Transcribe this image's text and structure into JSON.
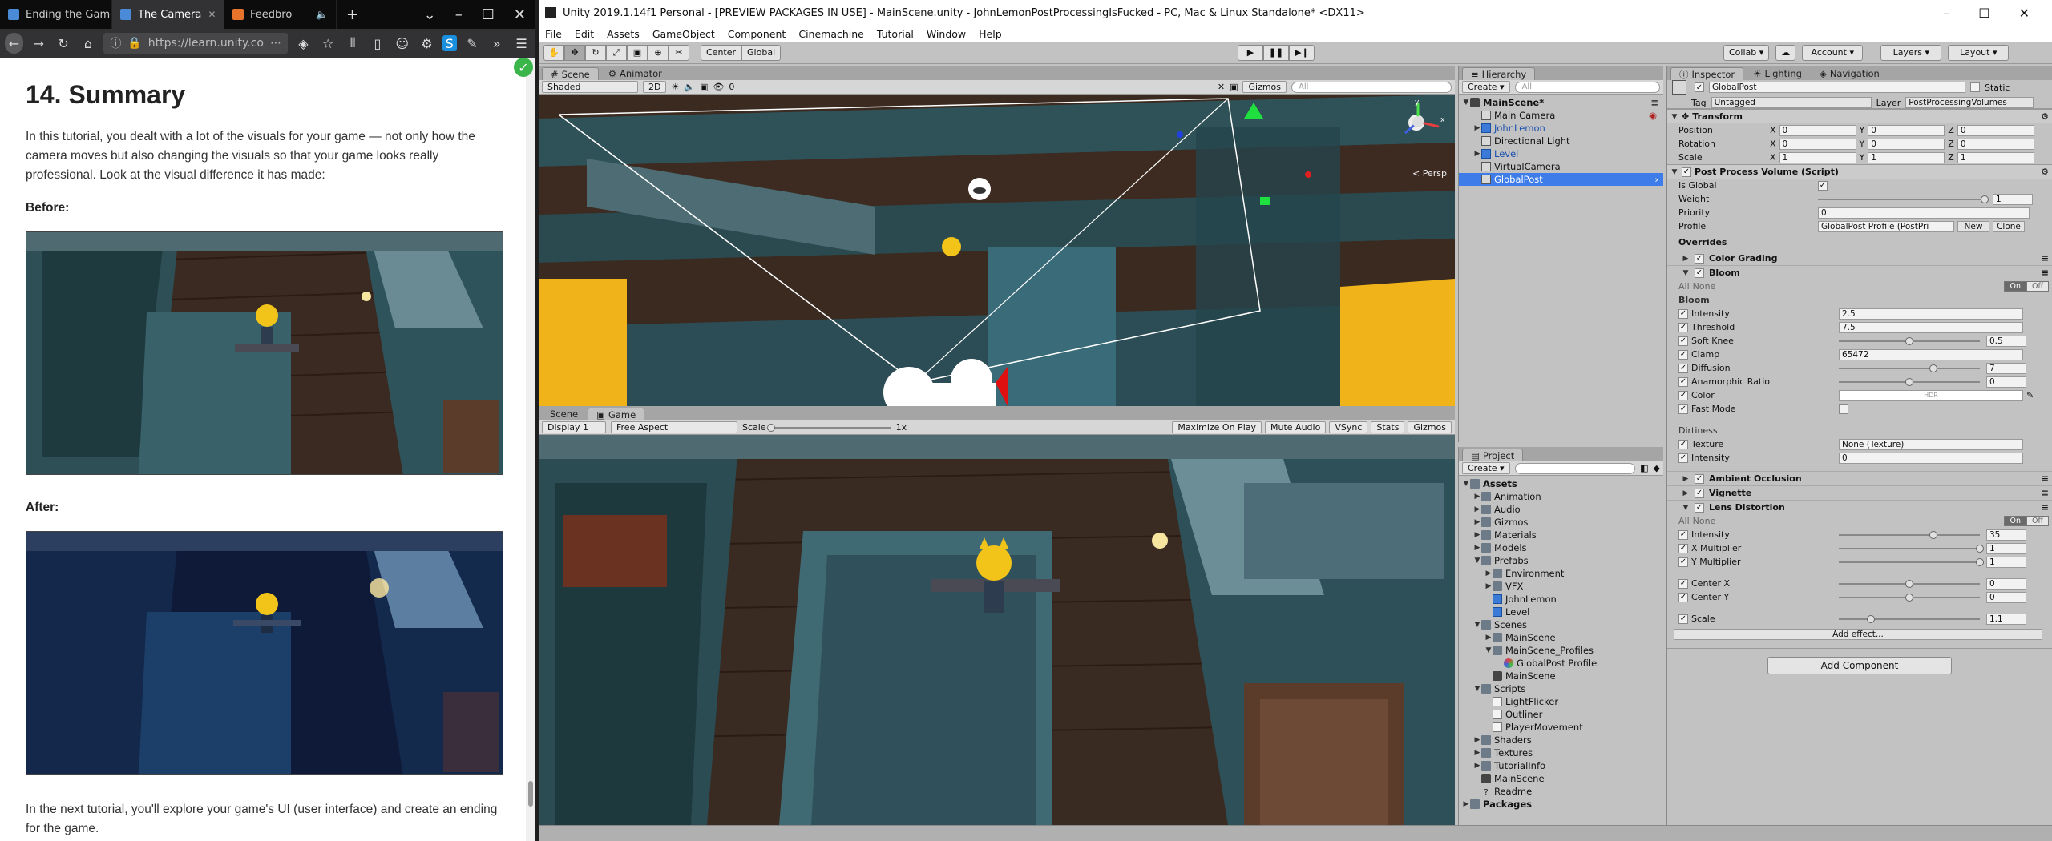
{
  "browser": {
    "tabs": [
      {
        "label": "Ending the Game",
        "active": false
      },
      {
        "label": "The Camera",
        "active": true
      },
      {
        "label": "Feedbro",
        "active": false
      }
    ],
    "url": "https://learn.unity.co",
    "article": {
      "heading": "14. Summary",
      "intro": "In this tutorial, you dealt with a lot of the visuals for your game — not only how the camera moves but also changing the visuals so that your game looks really professional. Look at the visual difference it has made:",
      "before_label": "Before:",
      "after_label": "After:",
      "outro": "In the next tutorial, you'll explore your game's UI (user interface) and create an ending for the game."
    }
  },
  "unity": {
    "title": "Unity 2019.1.14f1 Personal - [PREVIEW PACKAGES IN USE] - MainScene.unity - JohnLemonPostProcessingIsFucked - PC, Mac & Linux Standalone* <DX11>",
    "menu": [
      "File",
      "Edit",
      "Assets",
      "GameObject",
      "Component",
      "Cinemachine",
      "Tutorial",
      "Window",
      "Help"
    ],
    "toolbar": {
      "pivot": "Center",
      "space": "Global",
      "collab": "Collab",
      "account": "Account",
      "layers": "Layers",
      "layout": "Layout"
    },
    "scene_view": {
      "tabs": [
        "Scene",
        "Animator"
      ],
      "shading": "Shaded",
      "mode2d": "2D",
      "gizmos": "Gizmos",
      "search_placeholder": "All",
      "persp": "< Persp",
      "effects_count": "0"
    },
    "game_view": {
      "tabs": [
        "Scene",
        "Game"
      ],
      "display": "Display 1",
      "aspect": "Free Aspect",
      "scale_label": "Scale",
      "scale_value": "1x",
      "buttons": [
        "Maximize On Play",
        "Mute Audio",
        "VSync",
        "Stats",
        "Gizmos"
      ]
    },
    "hierarchy": {
      "tab": "Hierarchy",
      "create": "Create",
      "search_placeholder": "All",
      "scene": "MainScene*",
      "items": [
        {
          "label": "Main Camera",
          "blue": false,
          "expandable": false
        },
        {
          "label": "JohnLemon",
          "blue": true,
          "expandable": true
        },
        {
          "label": "Directional Light",
          "blue": false,
          "expandable": false
        },
        {
          "label": "Level",
          "blue": true,
          "expandable": true
        },
        {
          "label": "VirtualCamera",
          "blue": false,
          "expandable": false
        },
        {
          "label": "GlobalPost",
          "blue": false,
          "expandable": false,
          "selected": true
        }
      ]
    },
    "project": {
      "tab": "Project",
      "create": "Create",
      "root": "Assets",
      "items": [
        {
          "label": "Animation",
          "depth": 1,
          "type": "folder"
        },
        {
          "label": "Audio",
          "depth": 1,
          "type": "folder"
        },
        {
          "label": "Gizmos",
          "depth": 1,
          "type": "folder"
        },
        {
          "label": "Materials",
          "depth": 1,
          "type": "folder"
        },
        {
          "label": "Models",
          "depth": 1,
          "type": "folder"
        },
        {
          "label": "Prefabs",
          "depth": 1,
          "type": "folder",
          "open": true
        },
        {
          "label": "Environment",
          "depth": 2,
          "type": "folder"
        },
        {
          "label": "VFX",
          "depth": 2,
          "type": "folder"
        },
        {
          "label": "JohnLemon",
          "depth": 2,
          "type": "prefab"
        },
        {
          "label": "Level",
          "depth": 2,
          "type": "prefab"
        },
        {
          "label": "Scenes",
          "depth": 1,
          "type": "folder",
          "open": true
        },
        {
          "label": "MainScene",
          "depth": 2,
          "type": "folder"
        },
        {
          "label": "MainScene_Profiles",
          "depth": 2,
          "type": "folder",
          "open": true
        },
        {
          "label": "GlobalPost Profile",
          "depth": 3,
          "type": "profile"
        },
        {
          "label": "MainScene",
          "depth": 2,
          "type": "scene"
        },
        {
          "label": "Scripts",
          "depth": 1,
          "type": "folder",
          "open": true
        },
        {
          "label": "LightFlicker",
          "depth": 2,
          "type": "script"
        },
        {
          "label": "Outliner",
          "depth": 2,
          "type": "script"
        },
        {
          "label": "PlayerMovement",
          "depth": 2,
          "type": "script"
        },
        {
          "label": "Shaders",
          "depth": 1,
          "type": "folder"
        },
        {
          "label": "Textures",
          "depth": 1,
          "type": "folder"
        },
        {
          "label": "TutorialInfo",
          "depth": 1,
          "type": "folder"
        },
        {
          "label": "MainScene",
          "depth": 1,
          "type": "scene"
        },
        {
          "label": "Readme",
          "depth": 1,
          "type": "readme"
        }
      ],
      "packages": "Packages"
    },
    "inspector": {
      "tabs": [
        "Inspector",
        "Lighting",
        "Navigation"
      ],
      "object_name": "GlobalPost",
      "static_label": "Static",
      "tag_label": "Tag",
      "tag_value": "Untagged",
      "layer_label": "Layer",
      "layer_value": "PostProcessingVolumes",
      "transform": {
        "title": "Transform",
        "rows": [
          {
            "label": "Position",
            "x": "0",
            "y": "0",
            "z": "0"
          },
          {
            "label": "Rotation",
            "x": "0",
            "y": "0",
            "z": "0"
          },
          {
            "label": "Scale",
            "x": "1",
            "y": "1",
            "z": "1"
          }
        ]
      },
      "ppv": {
        "title": "Post Process Volume (Script)",
        "is_global": "Is Global",
        "weight_label": "Weight",
        "weight_value": "1",
        "priority_label": "Priority",
        "priority_value": "0",
        "profile_label": "Profile",
        "profile_value": "GlobalPost Profile (PostPri",
        "new": "New",
        "clone": "Clone"
      },
      "overrides": "Overrides",
      "color_grading": "Color Grading",
      "bloom": {
        "title": "Bloom",
        "all": "All",
        "none": "None",
        "on": "On",
        "off": "Off",
        "section": "Bloom",
        "fields": [
          {
            "label": "Intensity",
            "value": "2.5",
            "kind": "text"
          },
          {
            "label": "Threshold",
            "value": "7.5",
            "kind": "text"
          },
          {
            "label": "Soft Knee",
            "value": "0.5",
            "kind": "slider",
            "level": 0.5
          },
          {
            "label": "Clamp",
            "value": "65472",
            "kind": "text"
          },
          {
            "label": "Diffusion",
            "value": "7",
            "kind": "slider",
            "level": 0.67
          },
          {
            "label": "Anamorphic Ratio",
            "value": "0",
            "kind": "slider",
            "level": 0.5
          }
        ],
        "color_label": "Color",
        "color_value": "HDR",
        "fast_mode": "Fast Mode",
        "dirtiness": "Dirtiness",
        "texture_label": "Texture",
        "texture_value": "None (Texture)",
        "dirt_intensity_label": "Intensity",
        "dirt_intensity_value": "0"
      },
      "ambient_occlusion": "Ambient Occlusion",
      "vignette": "Vignette",
      "lens": {
        "title": "Lens Distortion",
        "all": "All",
        "none": "None",
        "on": "On",
        "off": "Off",
        "fields": [
          {
            "label": "Intensity",
            "value": "35",
            "level": 0.67
          },
          {
            "label": "X Multiplier",
            "value": "1",
            "level": 1.0
          },
          {
            "label": "Y Multiplier",
            "value": "1",
            "level": 1.0
          },
          {
            "label": "Center X",
            "value": "0",
            "level": 0.5
          },
          {
            "label": "Center Y",
            "value": "0",
            "level": 0.5
          },
          {
            "label": "Scale",
            "value": "1.1",
            "level": 0.23
          }
        ]
      },
      "add_effect": "Add effect...",
      "add_component": "Add Component"
    }
  }
}
